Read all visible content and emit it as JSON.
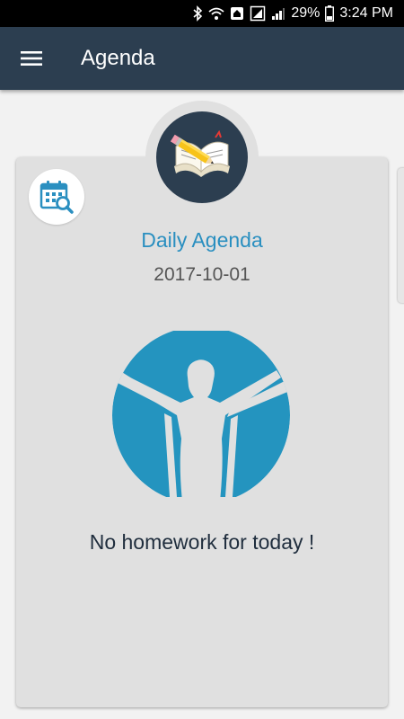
{
  "status_bar": {
    "battery": "29%",
    "time": "3:24 PM",
    "icons": [
      "bluetooth-icon",
      "wifi-icon",
      "notification-icon",
      "sim-icon",
      "signal-icon",
      "battery-icon"
    ]
  },
  "app_bar": {
    "title": "Agenda",
    "menu_icon": "hamburger-menu-icon",
    "background": "#2c3e50"
  },
  "card": {
    "header_icon": "book-pencil-icon",
    "calendar_button_icon": "calendar-search-icon",
    "title": "Daily Agenda",
    "date": "2017-10-01",
    "illustration": "celebrating-person-icon",
    "message": "No homework for today !",
    "accent_color": "#2a8fc0"
  }
}
